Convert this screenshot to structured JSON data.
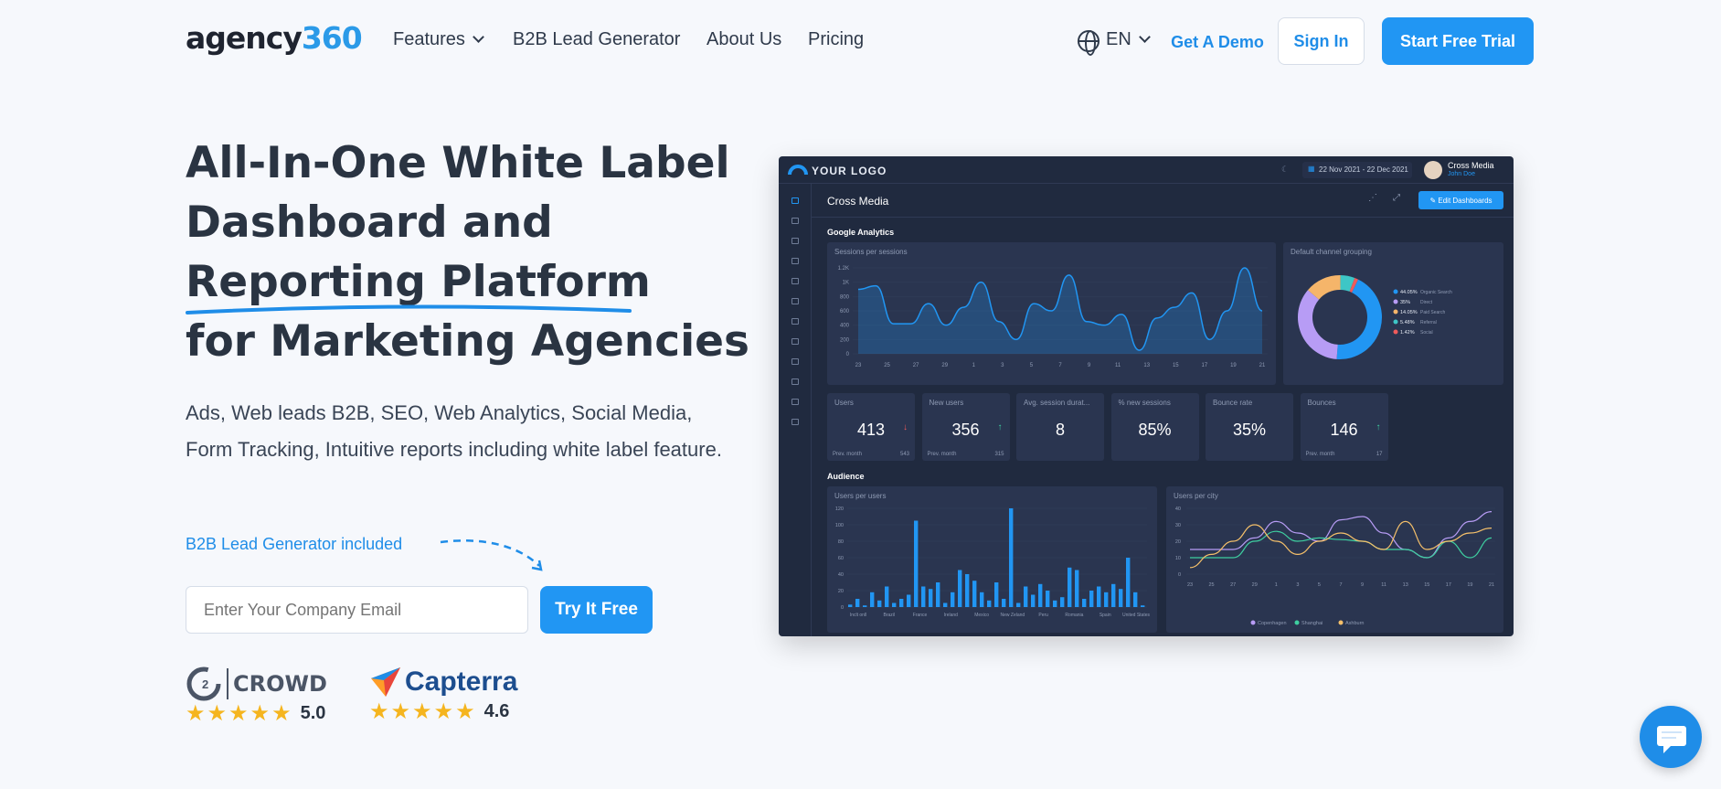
{
  "nav": {
    "logo_text": "agency",
    "logo_num": "360",
    "items": [
      "Features",
      "B2B Lead Generator",
      "About Us",
      "Pricing"
    ],
    "lang": "EN",
    "demo": "Get A Demo",
    "signin": "Sign In",
    "trial": "Start Free Trial"
  },
  "hero": {
    "line1": "All-In-One White Label",
    "line2": "Dashboard and",
    "line3": "Reporting Platform",
    "line4": "for Marketing Agencies",
    "sub": "Ads, Web leads B2B, SEO, Web Analytics, Social Media, Form Tracking, Intuitive reports including white label feature.",
    "b2b": "B2B Lead Generator included",
    "email_placeholder": "Enter Your Company Email",
    "try": "Try It Free"
  },
  "ratings": {
    "g2": "CROWD",
    "g2_score": "5.0",
    "capterra": "Capterra",
    "capterra_score": "4.6"
  },
  "dashboard": {
    "logo": "YOUR LOGO",
    "date": "22 Nov 2021 - 22 Dec 2021",
    "company": "Cross Media",
    "user": "John Doe",
    "title": "Cross Media",
    "edit": "Edit Dashboards",
    "section1": "Google Analytics",
    "sessions_title": "Sessions per sessions",
    "channel_title": "Default channel grouping",
    "section2": "Audience",
    "users_title": "Users per users",
    "city_title": "Users per city",
    "kpis": [
      {
        "label": "Users",
        "value": "413",
        "prev": "Prev. month",
        "prev_val": "543"
      },
      {
        "label": "New users",
        "value": "356",
        "prev": "Prev. month",
        "prev_val": "315"
      },
      {
        "label": "Avg. session durat...",
        "value": "8",
        "prev": "",
        "prev_val": ""
      },
      {
        "label": "% new sessions",
        "value": "85%",
        "prev": "",
        "prev_val": ""
      },
      {
        "label": "Bounce rate",
        "value": "35%",
        "prev": "",
        "prev_val": ""
      },
      {
        "label": "Bounces",
        "value": "146",
        "prev": "Prev. month",
        "prev_val": "17"
      }
    ]
  },
  "chart_data": [
    {
      "type": "area",
      "title": "Sessions per sessions",
      "x": [
        "23",
        "25",
        "27",
        "29",
        "1",
        "3",
        "5",
        "7",
        "9",
        "11",
        "13",
        "15",
        "17",
        "19",
        "21"
      ],
      "ylim": [
        0,
        1200
      ],
      "yticks": [
        "1.2K",
        "1K",
        "800",
        "600",
        "400",
        "200",
        "0"
      ],
      "values": [
        900,
        950,
        420,
        420,
        700,
        400,
        650,
        1000,
        450,
        200,
        700,
        600,
        1100,
        450,
        400,
        550,
        50,
        500,
        650,
        850,
        200,
        600,
        1200,
        600
      ]
    },
    {
      "type": "pie",
      "title": "Default channel grouping",
      "labels": [
        "Organic Search",
        "Direct",
        "Paid Search",
        "Referral",
        "Social"
      ],
      "values": [
        44.05,
        35,
        14.05,
        5.48,
        1.42
      ],
      "pct_labels": [
        "44.05%",
        "35%",
        "14.05%",
        "5.48%",
        "1.42%"
      ],
      "colors": [
        "#2196f3",
        "#b79cf5",
        "#f5b56a",
        "#3ec6c6",
        "#ef5b5b"
      ]
    },
    {
      "type": "bar",
      "title": "Users per users",
      "categories": [
        "Inclt onll",
        "Brazil",
        "France",
        "Ireland",
        "Mexico",
        "New Zeland",
        "Peru",
        "Romania",
        "Spain",
        "United States"
      ],
      "ylim": [
        0,
        120
      ],
      "yticks": [
        "120",
        "100",
        "80",
        "60",
        "40",
        "20",
        "0"
      ],
      "values": [
        3,
        10,
        2,
        18,
        8,
        25,
        5,
        10,
        15,
        105,
        25,
        22,
        30,
        5,
        18,
        45,
        40,
        32,
        18,
        8,
        30,
        10,
        120,
        5,
        25,
        15,
        28,
        20,
        8,
        12,
        48,
        45,
        10,
        20,
        25,
        18,
        28,
        22,
        60,
        18,
        2
      ]
    },
    {
      "type": "line",
      "title": "Users per city",
      "x": [
        "23",
        "25",
        "27",
        "29",
        "1",
        "3",
        "5",
        "7",
        "9",
        "11",
        "13",
        "15",
        "17",
        "19",
        "21"
      ],
      "ylim": [
        0,
        40
      ],
      "yticks": [
        "40",
        "30",
        "20",
        "10",
        "0"
      ],
      "series": [
        {
          "name": "Copenhagen",
          "values": [
            15,
            15,
            15,
            22,
            32,
            25,
            20,
            33,
            35,
            25,
            15,
            10,
            22,
            32,
            38
          ]
        },
        {
          "name": "Shanghai",
          "values": [
            10,
            10,
            10,
            20,
            26,
            20,
            22,
            21,
            20,
            15,
            15,
            10,
            20,
            10,
            22
          ]
        },
        {
          "name": "Ashburn",
          "values": [
            4,
            12,
            20,
            30,
            20,
            12,
            20,
            25,
            20,
            15,
            32,
            15,
            20,
            25,
            28
          ]
        }
      ],
      "colors": [
        "#b79cf5",
        "#3ecfa0",
        "#f5c06a"
      ]
    }
  ]
}
